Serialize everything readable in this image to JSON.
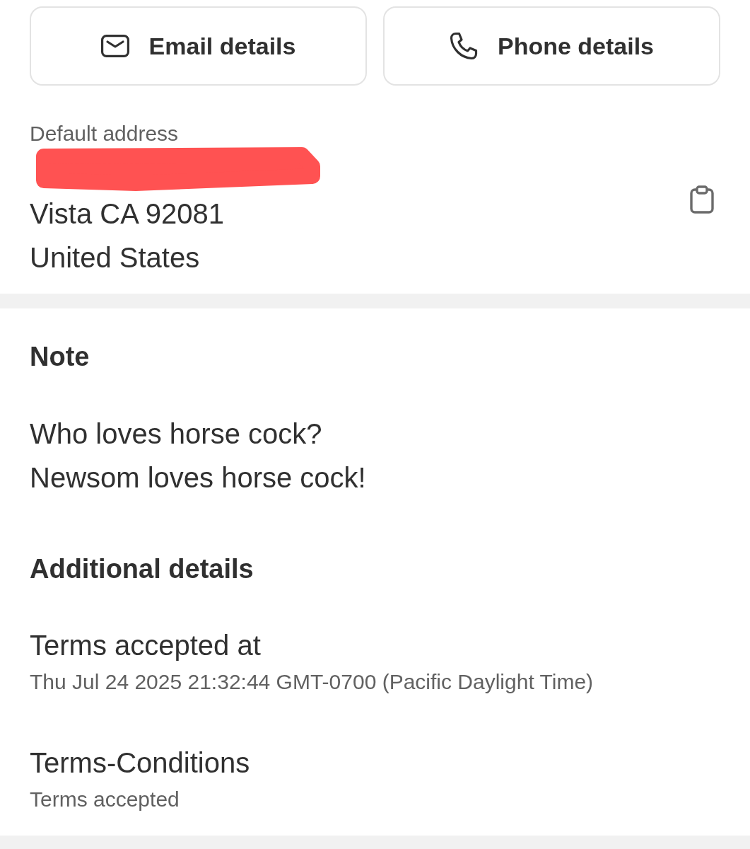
{
  "contact_buttons": [
    {
      "kind": "email",
      "label": "Email details"
    },
    {
      "kind": "phone",
      "label": "Phone details"
    }
  ],
  "address": {
    "label": "Default address",
    "redacted_line": true,
    "lines": [
      "Vista CA 92081",
      "United States"
    ]
  },
  "note": {
    "title": "Note",
    "lines": [
      "Who loves horse cock?",
      "Newsom loves horse cock!"
    ]
  },
  "additional_details": {
    "title": "Additional details",
    "fields": [
      {
        "label": "Terms accepted at",
        "value": "Thu Jul 24 2025 21:32:44 GMT-0700 (Pacific Daylight Time)"
      },
      {
        "label": "Terms-Conditions",
        "value": "Terms accepted"
      }
    ]
  }
}
